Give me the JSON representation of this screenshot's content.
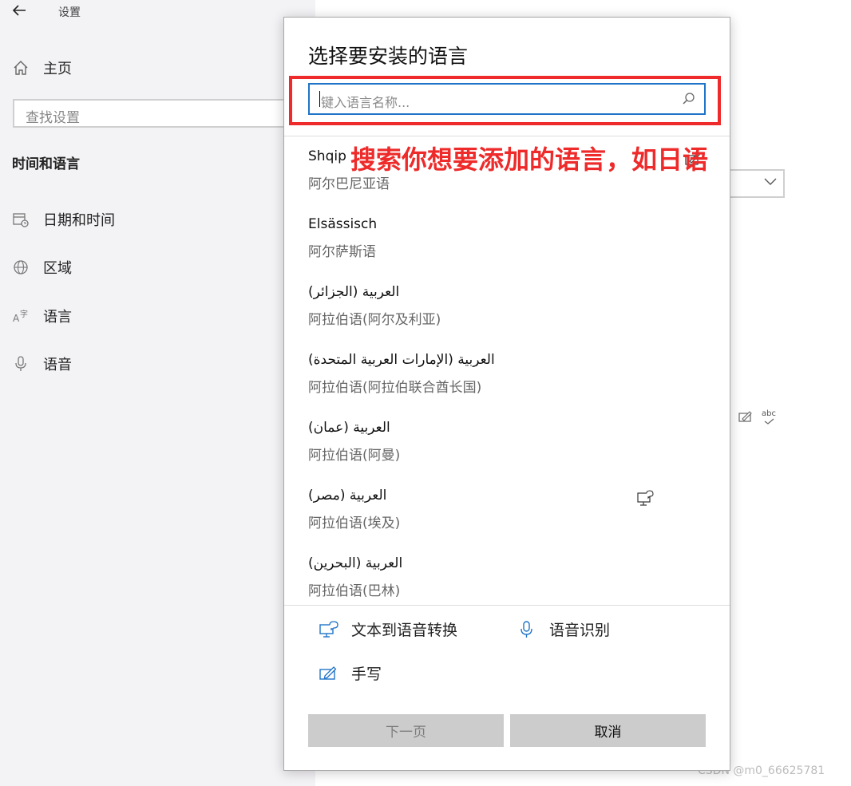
{
  "settings": {
    "app_title": "设置",
    "home_label": "主页",
    "search_placeholder": "查找设置",
    "section_title": "时间和语言",
    "nav_items": [
      {
        "label": "日期和时间",
        "icon": "calendar-clock-icon"
      },
      {
        "label": "区域",
        "icon": "globe-icon"
      },
      {
        "label": "语言",
        "icon": "language-icon"
      },
      {
        "label": "语音",
        "icon": "microphone-icon"
      }
    ]
  },
  "dialog": {
    "title": "选择要安装的语言",
    "search_placeholder": "键入语言名称...",
    "annotation": "搜索你想要添加的语言，如日语",
    "languages": [
      {
        "native": "Shqip",
        "chinese": "阿尔巴尼亚语"
      },
      {
        "native": "Elsässisch",
        "chinese": "阿尔萨斯语"
      },
      {
        "native": "العربية (الجزائر)",
        "chinese": "阿拉伯语(阿尔及利亚)"
      },
      {
        "native": "العربية (الإمارات العربية المتحدة)",
        "chinese": "阿拉伯语(阿拉伯联合酋长国)"
      },
      {
        "native": "العربية (عمان)",
        "chinese": "阿拉伯语(阿曼)"
      },
      {
        "native": "العربية (مصر)",
        "chinese": "阿拉伯语(埃及)"
      },
      {
        "native": "العربية (البحرين)",
        "chinese": "阿拉伯语(巴林)"
      }
    ],
    "features": {
      "tts": "文本到语音转换",
      "speech": "语音识别",
      "handwriting": "手写"
    },
    "buttons": {
      "next": "下一页",
      "cancel": "取消"
    }
  },
  "background": {
    "abc_label": "abc"
  },
  "watermark": "CSDN @m0_66625781",
  "colors": {
    "accent": "#1f74c8",
    "annotation_red": "#ee2a2a",
    "pane_bg": "#f3f2f5",
    "button_bg": "#cccccc"
  }
}
